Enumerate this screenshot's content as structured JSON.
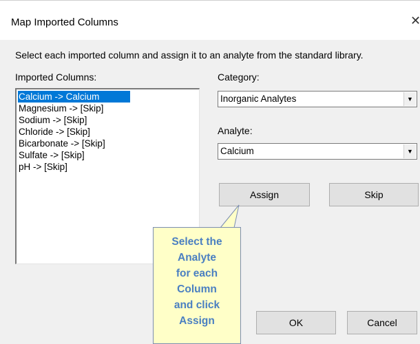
{
  "dialog": {
    "title": "Map Imported Columns",
    "close_glyph": "✕",
    "instruction": "Select each imported column and assign it to an analyte from the standard library."
  },
  "imported_columns": {
    "label": "Imported Columns:",
    "items": [
      "Calcium  -> Calcium",
      "Magnesium  -> [Skip]",
      "Sodium  -> [Skip]",
      "Chloride  -> [Skip]",
      "Bicarbonate  -> [Skip]",
      "Sulfate  -> [Skip]",
      "pH  -> [Skip]"
    ],
    "selected_index": 0
  },
  "category": {
    "label": "Category:",
    "value": "Inorganic Analytes",
    "dropdown_icon": "▼"
  },
  "analyte": {
    "label": "Analyte:",
    "value": "Calcium",
    "dropdown_icon": "▼"
  },
  "buttons": {
    "assign": "Assign",
    "skip": "Skip",
    "ok": "OK",
    "cancel": "Cancel"
  },
  "callout": {
    "lines": [
      "Select the",
      "Analyte",
      "for each",
      "Column",
      "and click",
      "Assign"
    ]
  },
  "colors": {
    "selection": "#0078d7",
    "callout_bg": "#ffffc8",
    "callout_text": "#4a7fc1"
  }
}
